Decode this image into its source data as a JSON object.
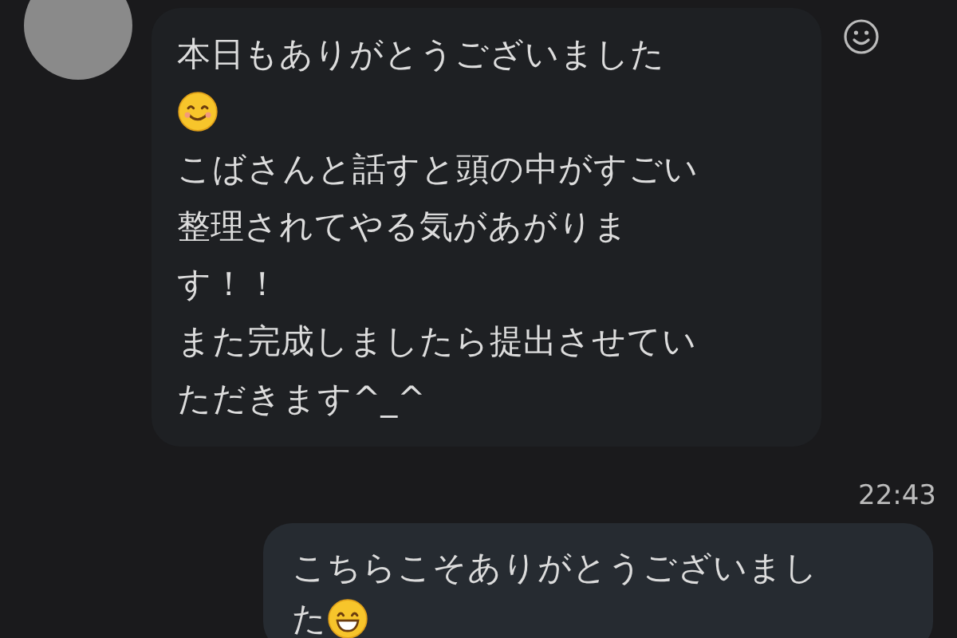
{
  "incoming": {
    "lines": [
      {
        "kind": "text",
        "text": "本日もありがとうございました"
      },
      {
        "kind": "smile"
      },
      {
        "kind": "text",
        "text": "こばさんと話すと頭の中がすごい"
      },
      {
        "kind": "text",
        "text": "整理されてやる気があがりま"
      },
      {
        "kind": "text",
        "text": "す！！"
      },
      {
        "kind": "text",
        "text": "また完成しましたら提出させてい"
      },
      {
        "kind": "text",
        "text": "ただきます^_^"
      }
    ]
  },
  "outgoing": {
    "time": "22:43",
    "lines": [
      {
        "kind": "text",
        "text": "こちらこそありがとうございまし"
      },
      {
        "kind": "grin",
        "text": "た"
      }
    ]
  }
}
